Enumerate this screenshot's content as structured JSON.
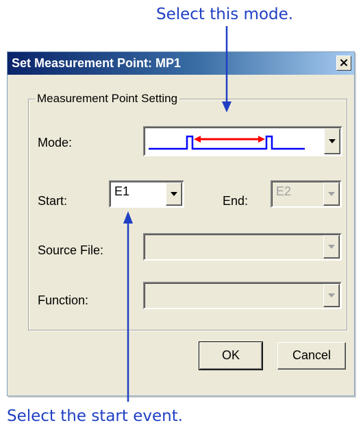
{
  "annotations": {
    "top": "Select this mode.",
    "bottom": "Select the start event."
  },
  "dialog": {
    "title": "Set Measurement Point: MP1",
    "close_glyph": "×",
    "group_label": "Measurement Point Setting",
    "mode": {
      "label": "Mode:",
      "selected_icon": "pulse-interval-icon"
    },
    "start": {
      "label": "Start:",
      "value": "E1"
    },
    "end": {
      "label": "End:",
      "value": "E2"
    },
    "source_file": {
      "label": "Source File:",
      "value": ""
    },
    "function": {
      "label": "Function:",
      "value": ""
    },
    "ok_label": "OK",
    "cancel_label": "Cancel"
  },
  "colors": {
    "annotation": "#1f3fc4",
    "pulse_line": "#0000ff",
    "interval_arrow": "#ff0000",
    "title_bar": "#0a246a"
  }
}
